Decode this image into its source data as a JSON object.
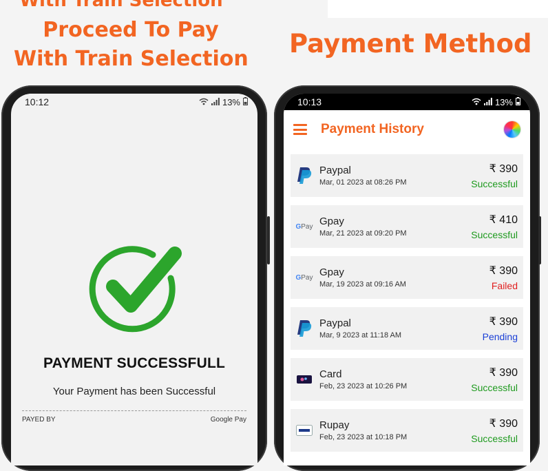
{
  "headings": {
    "left_cutoff": "With Train Selection",
    "left_line1": "Proceed To Pay",
    "left_line2": "With Train Selection",
    "right": "Payment Method"
  },
  "left_phone": {
    "time": "10:12",
    "battery": "13%",
    "title": "PAYMENT SUCCESSFULL",
    "subtitle": "Your Payment has been Successful",
    "payed_by_label": "PAYED BY",
    "payed_by_value": "Google Pay"
  },
  "right_phone": {
    "time": "10:13",
    "battery": "13%",
    "app_title": "Payment History",
    "gpay_logo_text": "Pay",
    "payments": [
      {
        "name": "Paypal",
        "date": "Mar, 01 2023 at 08:26 PM",
        "amount": "₹ 390",
        "status": "Successful",
        "logo": "paypal"
      },
      {
        "name": "Gpay",
        "date": "Mar, 21 2023 at 09:20 PM",
        "amount": "₹ 410",
        "status": "Successful",
        "logo": "gpay"
      },
      {
        "name": "Gpay",
        "date": "Mar, 19 2023 at 09:16 AM",
        "amount": "₹ 390",
        "status": "Failed",
        "logo": "gpay"
      },
      {
        "name": "Paypal",
        "date": "Mar, 9 2023 at 11:18 AM",
        "amount": "₹ 390",
        "status": "Pending",
        "logo": "paypal"
      },
      {
        "name": "Card",
        "date": "Feb, 23 2023 at 10:26 PM",
        "amount": "₹ 390",
        "status": "Successful",
        "logo": "card"
      },
      {
        "name": "Rupay",
        "date": "Feb, 23 2023 at 10:18 PM",
        "amount": "₹ 390",
        "status": "Successful",
        "logo": "rupay"
      }
    ]
  },
  "colors": {
    "accent": "#f26522",
    "success": "#1e9a1e",
    "failed": "#e02020",
    "pending": "#1a3fd6",
    "check": "#2ca52c"
  }
}
